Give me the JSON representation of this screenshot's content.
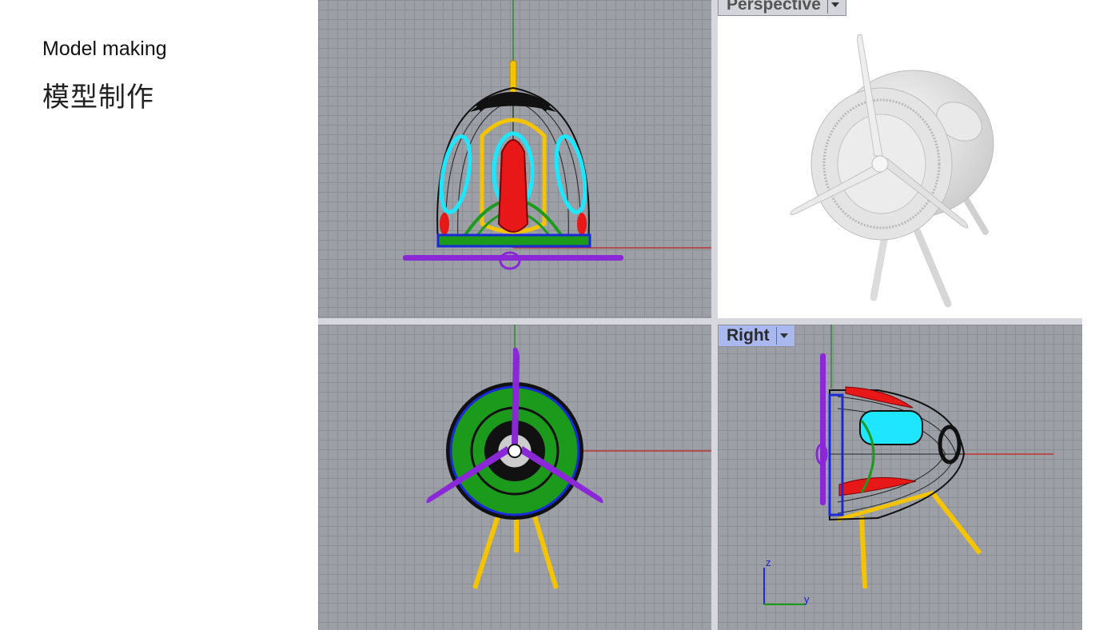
{
  "heading": {
    "title_en": "Model making",
    "title_cn": "模型制作"
  },
  "viewports": {
    "top_left": {
      "name": "front-wireframe"
    },
    "top_right": {
      "label": "Perspective"
    },
    "bottom_left": {
      "name": "top-wireframe"
    },
    "bottom_right": {
      "label": "Right"
    }
  },
  "axis_widget": {
    "z_label": "z",
    "y_label": "y"
  },
  "colors": {
    "grid": "#9ca0a6",
    "gridline": "#8a8e94",
    "axis_x": "#b33",
    "axis_y": "#2a8a2a",
    "yellow": "#f5c400",
    "cyan": "#1ee6ff",
    "red": "#e81818",
    "green": "#1c9a1c",
    "purple": "#8a28d8",
    "blue": "#1a2ad6"
  }
}
